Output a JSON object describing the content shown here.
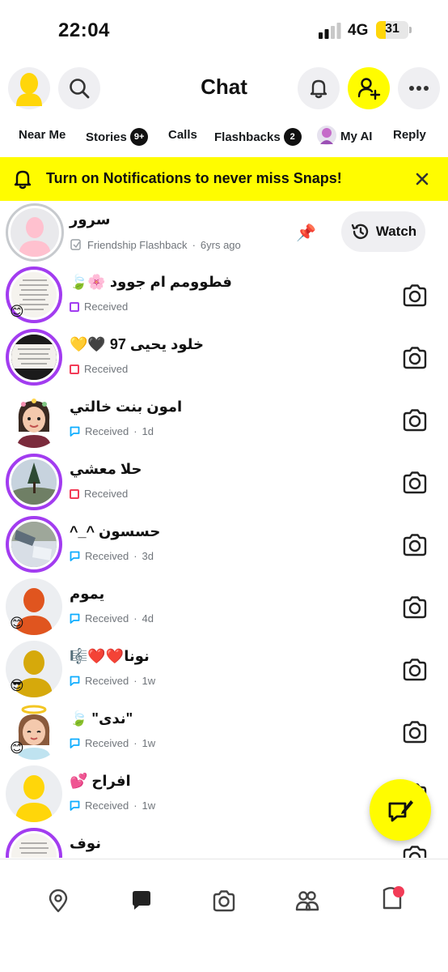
{
  "status_bar": {
    "time": "22:04",
    "network": "4G",
    "battery": "31",
    "battery_level": 0.31
  },
  "header": {
    "title": "Chat"
  },
  "tabs": [
    {
      "label": "Near Me"
    },
    {
      "label": "Stories",
      "badge": "9+"
    },
    {
      "label": "Calls"
    },
    {
      "label": "Flashbacks",
      "badge": "2"
    },
    {
      "label": "My AI"
    },
    {
      "label": "Reply"
    }
  ],
  "notification": {
    "text": "Turn on Notifications to never miss Snaps!"
  },
  "pinned": {
    "name": "سرور",
    "status": "Friendship Flashback",
    "time": "6yrs ago",
    "watch_label": "Watch"
  },
  "chats": [
    {
      "name": "فطوومم ام جوود 🌸🍃",
      "status": "Received",
      "time": "",
      "indicator": "snap-purple",
      "emoji": "😊",
      "avatar": "story-text"
    },
    {
      "name": "خلود يحيى 97 🖤💛",
      "status": "Received",
      "time": "",
      "indicator": "snap-red",
      "emoji": "",
      "avatar": "story-dark"
    },
    {
      "name": "امون بنت خالتي",
      "status": "Received",
      "time": "1d",
      "indicator": "chat-blue",
      "emoji": "",
      "avatar": "bitmoji-girl"
    },
    {
      "name": "حلا معشي",
      "status": "Received",
      "time": "",
      "indicator": "snap-red",
      "emoji": "",
      "avatar": "story-tree"
    },
    {
      "name": "حسسون ^_^",
      "status": "Received",
      "time": "3d",
      "indicator": "chat-blue",
      "emoji": "",
      "avatar": "story-photo"
    },
    {
      "name": "يموم",
      "status": "Received",
      "time": "4d",
      "indicator": "chat-blue",
      "emoji": "😊",
      "avatar": "silhouette-orange"
    },
    {
      "name": "نونا❤️❤️🎼",
      "status": "Received",
      "time": "1w",
      "indicator": "chat-blue",
      "emoji": "😎",
      "avatar": "silhouette-gold"
    },
    {
      "name": "\"ندى\" 🍃",
      "status": "Received",
      "time": "1w",
      "indicator": "chat-blue",
      "emoji": "😊",
      "avatar": "bitmoji-angel"
    },
    {
      "name": "افراح 💕",
      "status": "Received",
      "time": "1w",
      "indicator": "chat-blue",
      "emoji": "",
      "avatar": "silhouette-yellow"
    },
    {
      "name": "نوف",
      "status": "",
      "time": "",
      "indicator": "",
      "emoji": "",
      "avatar": "story-text"
    }
  ],
  "colors": {
    "snap_yellow": "#fffc00",
    "story_purple": "#a23cf0",
    "snap_red": "#f23c57",
    "chat_blue": "#0eadff"
  }
}
